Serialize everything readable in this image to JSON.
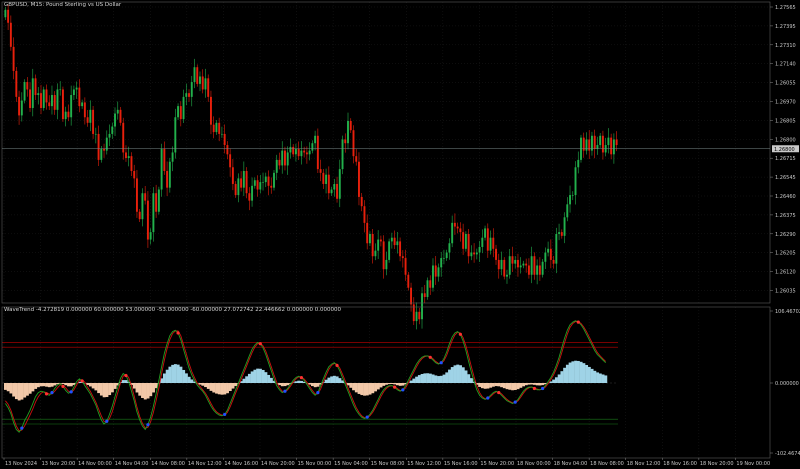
{
  "window": {
    "title": "GBPUSD, M15: Pound Sterling vs US Dollar"
  },
  "indicator": {
    "title": "WaveTrend -4.272819 0.000000 60.000000 53.000000 -53.000000 -60.000000 27.072742 22.446662 0.000000 0.000000",
    "scale_labels": [
      "106.467022",
      "0.000000",
      "-102.467466"
    ]
  },
  "price_axis": {
    "labels": [
      "1.27565",
      "1.27395",
      "1.27310",
      "1.27140",
      "1.26055",
      "1.26970",
      "1.26805",
      "1.26800",
      "1.26715",
      "1.26545",
      "1.26460",
      "1.26375",
      "1.26290",
      "1.26205",
      "1.26120",
      "1.26035"
    ],
    "current_price": "1.26800"
  },
  "time_axis": {
    "labels": [
      "13 Nov 2024",
      "13 Nov 20:00",
      "14 Nov 00:00",
      "14 Nov 04:00",
      "14 Nov 08:00",
      "14 Nov 12:00",
      "14 Nov 16:00",
      "14 Nov 20:00",
      "15 Nov 00:00",
      "15 Nov 04:00",
      "15 Nov 08:00",
      "15 Nov 12:00",
      "15 Nov 16:00",
      "15 Nov 20:00",
      "18 Nov 00:00",
      "18 Nov 04:00",
      "18 Nov 08:00",
      "18 Nov 12:00",
      "18 Nov 16:00",
      "18 Nov 20:00",
      "19 Nov 00:00"
    ]
  },
  "colors": {
    "background": "#000000",
    "grid": "#1c1c1c",
    "bull": "#22b14c",
    "bear": "#e8200c",
    "wt1": "#22a022",
    "wt2": "#cc1010",
    "hist_pos": "#9fd3e6",
    "hist_neg": "#f2c8a8",
    "ob_level": "#c00000",
    "os_level": "#1a7a1a"
  },
  "chart_data": {
    "type": "candlestick",
    "close": [
      1.2755,
      1.2748,
      1.2735,
      1.2722,
      1.2708,
      1.2698,
      1.2706,
      1.2716,
      1.2712,
      1.2702,
      1.2718,
      1.2709,
      1.271,
      1.2702,
      1.2712,
      1.2705,
      1.2703,
      1.2709,
      1.2701,
      1.2712,
      1.2712,
      1.2696,
      1.27,
      1.2697,
      1.2709,
      1.2712,
      1.2713,
      1.2703,
      1.2705,
      1.2697,
      1.2694,
      1.2701,
      1.2688,
      1.2688,
      1.2674,
      1.268,
      1.2679,
      1.2686,
      1.2688,
      1.2692,
      1.2699,
      1.2701,
      1.2694,
      1.2678,
      1.2675,
      1.2676,
      1.2668,
      1.2664,
      1.2646,
      1.2642,
      1.2656,
      1.2652,
      1.2631,
      1.2635,
      1.2656,
      1.2646,
      1.2658,
      1.268,
      1.2668,
      1.2659,
      1.2673,
      1.2678,
      1.2697,
      1.2703,
      1.2696,
      1.2708,
      1.271,
      1.2708,
      1.2716,
      1.2724,
      1.2715,
      1.2719,
      1.2712,
      1.2718,
      1.2708,
      1.2693,
      1.2689,
      1.2694,
      1.2688,
      1.2688,
      1.2682,
      1.2677,
      1.267,
      1.2661,
      1.2655,
      1.2664,
      1.2659,
      1.2668,
      1.2656,
      1.2652,
      1.266,
      1.2663,
      1.2658,
      1.2662,
      1.2662,
      1.2665,
      1.266,
      1.2659,
      1.2667,
      1.2674,
      1.2671,
      1.2679,
      1.2671,
      1.2678,
      1.2681,
      1.2677,
      1.268,
      1.2676,
      1.2679,
      1.2678,
      1.2677,
      1.2679,
      1.2683,
      1.2687,
      1.2669,
      1.2667,
      1.2661,
      1.2666,
      1.2656,
      1.2658,
      1.2661,
      1.2653,
      1.2669,
      1.2685,
      1.2683,
      1.2695,
      1.269,
      1.2676,
      1.2673,
      1.2654,
      1.2649,
      1.264,
      1.2629,
      1.2634,
      1.2622,
      1.2625,
      1.2631,
      1.263,
      1.2615,
      1.262,
      1.263,
      1.2632,
      1.2628,
      1.263,
      1.2622,
      1.2621,
      1.2612,
      1.2605,
      1.2596,
      1.2587,
      1.2592,
      1.2588,
      1.2602,
      1.26,
      1.2609,
      1.2605,
      1.2617,
      1.2611,
      1.2616,
      1.2621,
      1.2621,
      1.2624,
      1.2629,
      1.264,
      1.2638,
      1.2637,
      1.2635,
      1.2626,
      1.2634,
      1.2622,
      1.2624,
      1.2623,
      1.2624,
      1.2627,
      1.2632,
      1.2637,
      1.2625,
      1.2632,
      1.2626,
      1.262,
      1.2615,
      1.262,
      1.2611,
      1.2612,
      1.2622,
      1.2618,
      1.262,
      1.2616,
      1.2617,
      1.2618,
      1.2617,
      1.2612,
      1.2622,
      1.2612,
      1.2617,
      1.2612,
      1.2619,
      1.2624,
      1.2626,
      1.262,
      1.2618,
      1.2634,
      1.2635,
      1.2633,
      1.2643,
      1.265,
      1.2655,
      1.2655,
      1.267,
      1.2674,
      1.2686,
      1.2679,
      1.2685,
      1.2679,
      1.2687,
      1.268,
      1.2682,
      1.2687,
      1.2678,
      1.2682,
      1.2686,
      1.2677,
      1.2685,
      1.2682
    ],
    "wt1": [
      -30,
      -36,
      -45,
      -58,
      -68,
      -72,
      -66,
      -55,
      -48,
      -40,
      -30,
      -20,
      -14,
      -12,
      -13,
      -16,
      -18,
      -14,
      -8,
      -3,
      -1,
      -5,
      -11,
      -15,
      -13,
      -6,
      2,
      6,
      3,
      -4,
      -10,
      -16,
      -24,
      -32,
      -44,
      -54,
      -60,
      -56,
      -46,
      -34,
      -20,
      -6,
      7,
      14,
      11,
      2,
      -12,
      -26,
      -42,
      -54,
      -63,
      -68,
      -61,
      -50,
      -34,
      -16,
      4,
      24,
      44,
      58,
      70,
      76,
      78,
      74,
      64,
      50,
      36,
      22,
      12,
      4,
      -3,
      -8,
      -12,
      -18,
      -26,
      -34,
      -40,
      -44,
      -47,
      -48,
      -46,
      -40,
      -30,
      -20,
      -10,
      0,
      10,
      20,
      30,
      40,
      50,
      56,
      60,
      58,
      52,
      42,
      30,
      18,
      6,
      -4,
      -10,
      -14,
      -12,
      -8,
      -2,
      4,
      8,
      10,
      8,
      4,
      -2,
      -8,
      -14,
      -18,
      -14,
      -4,
      6,
      16,
      24,
      28,
      30,
      26,
      18,
      8,
      -2,
      -12,
      -22,
      -32,
      -40,
      -46,
      -50,
      -52,
      -50,
      -46,
      -40,
      -32,
      -24,
      -16,
      -10,
      -6,
      -4,
      -4,
      -6,
      -10,
      -12,
      -10,
      -4,
      4,
      12,
      20,
      28,
      34,
      38,
      40,
      40,
      38,
      34,
      30,
      28,
      30,
      36,
      46,
      58,
      68,
      74,
      76,
      72,
      62,
      48,
      32,
      16,
      2,
      -10,
      -18,
      -22,
      -24,
      -22,
      -18,
      -14,
      -12,
      -14,
      -18,
      -22,
      -26,
      -28,
      -30,
      -28,
      -24,
      -18,
      -12,
      -8,
      -6,
      -6,
      -8,
      -10,
      -10,
      -8,
      -4,
      2,
      8,
      16,
      26,
      38,
      52,
      66,
      78,
      86,
      90,
      92,
      90,
      86,
      80,
      72,
      64,
      56,
      48,
      42,
      38,
      34,
      30
    ],
    "wt2": [
      -26,
      -31,
      -40,
      -52,
      -63,
      -70,
      -69,
      -63,
      -55,
      -47,
      -38,
      -28,
      -20,
      -15,
      -13,
      -14,
      -16,
      -16,
      -12,
      -7,
      -3,
      -3,
      -7,
      -12,
      -14,
      -10,
      -3,
      4,
      5,
      1,
      -6,
      -12,
      -20,
      -28,
      -38,
      -48,
      -56,
      -58,
      -52,
      -42,
      -28,
      -14,
      0,
      10,
      13,
      8,
      -4,
      -19,
      -35,
      -49,
      -59,
      -66,
      -65,
      -57,
      -43,
      -26,
      -7,
      14,
      34,
      51,
      64,
      73,
      77,
      77,
      70,
      57,
      43,
      29,
      17,
      8,
      0,
      -5,
      -10,
      -15,
      -22,
      -30,
      -37,
      -42,
      -45,
      -47,
      -47,
      -43,
      -35,
      -25,
      -15,
      -5,
      5,
      15,
      25,
      35,
      45,
      53,
      58,
      59,
      55,
      47,
      36,
      24,
      12,
      1,
      -7,
      -12,
      -13,
      -10,
      -5,
      1,
      6,
      9,
      9,
      6,
      1,
      -5,
      -11,
      -16,
      -16,
      -9,
      1,
      11,
      20,
      26,
      29,
      28,
      22,
      13,
      3,
      -7,
      -17,
      -27,
      -36,
      -43,
      -48,
      -51,
      -51,
      -48,
      -43,
      -36,
      -28,
      -20,
      -13,
      -8,
      -5,
      -4,
      -5,
      -8,
      -11,
      -11,
      -7,
      0,
      8,
      16,
      24,
      31,
      36,
      39,
      40,
      39,
      36,
      32,
      29,
      29,
      33,
      41,
      52,
      63,
      71,
      75,
      74,
      67,
      55,
      40,
      24,
      9,
      -4,
      -14,
      -20,
      -23,
      -23,
      -20,
      -16,
      -13,
      -13,
      -16,
      -20,
      -24,
      -27,
      -29,
      -29,
      -26,
      -21,
      -15,
      -10,
      -7,
      -6,
      -7,
      -9,
      -10,
      -9,
      -6,
      -1,
      5,
      12,
      21,
      32,
      45,
      59,
      72,
      82,
      88,
      91,
      91,
      88,
      83,
      76,
      68,
      60,
      52,
      45,
      40,
      36,
      32
    ]
  }
}
